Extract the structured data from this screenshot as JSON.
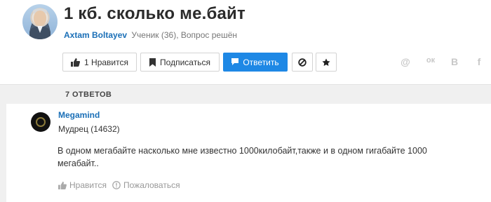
{
  "question": {
    "title": "1 кб. сколько ме.байт",
    "author": "Axtam Boltayev",
    "rank": "Ученик (36), Вопрос решён"
  },
  "toolbar": {
    "like_label": "1 Нравится",
    "subscribe_label": "Подписаться",
    "answer_label": "Ответить",
    "accent_color": "#1e88e5"
  },
  "share": {
    "mail": "@",
    "ok": "ок",
    "vk": "В",
    "fb": "f"
  },
  "answers_count": "7 ОТВЕТОВ",
  "answer": {
    "author": "Megamind",
    "rank": "Мудрец (14632)",
    "text": "В одном мегабайте насколько мне известно 1000килобайт,также и в одном гигабайте 1000 мегабайт..",
    "like_label": "Нравится",
    "report_label": "Пожаловаться"
  }
}
